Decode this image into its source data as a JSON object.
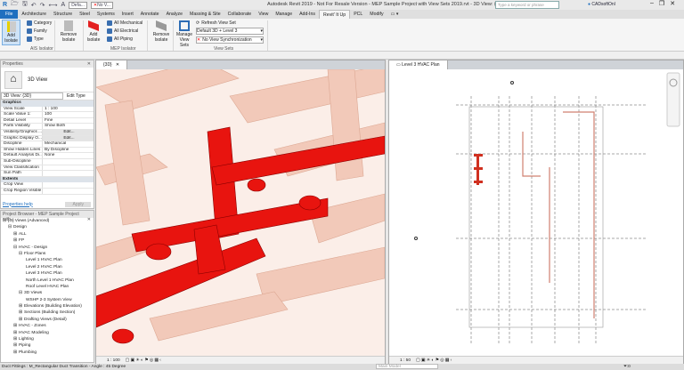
{
  "title": "Autodesk Revit 2019 - Not For Resale Version - MEP Sample Project with View Sets 2019.rvt - 3D View: {3D}",
  "qat": {
    "view_select": "Defa...",
    "sync_select": "No V..."
  },
  "search_placeholder": "Type a keyword or phrase",
  "user": "CADsoftOnl",
  "tabs": [
    "File",
    "Architecture",
    "Structure",
    "Steel",
    "Systems",
    "Insert",
    "Annotate",
    "Analyze",
    "Massing & Site",
    "Collaborate",
    "View",
    "Manage",
    "Add-Ins",
    "Revit' It Up",
    "PCL",
    "Modify",
    "▭ ▾"
  ],
  "active_tab": "Revit' It Up",
  "ribbon": {
    "ais": {
      "add_isolate": "Add Isolate",
      "category": "Category",
      "family": "Family",
      "type": "Type",
      "label": "AIS Isolator"
    },
    "remove_isolate_1": "Remove Isolate",
    "mep": {
      "add_isolate": "Add Isolate",
      "all_mechanical": "All Mechanical",
      "all_electrical": "All Electrical",
      "all_piping": "All Piping",
      "label": "MEP Isolator"
    },
    "remove_isolate_2": "Remove Isolate",
    "viewsets": {
      "manage": "Manage View Sets",
      "refresh": "Refresh View Set",
      "default_set": "Default 3D + Level 3",
      "sync": "No View Synchronization",
      "label": "View Sets"
    }
  },
  "properties": {
    "title": "Properties",
    "type_name": "3D View",
    "selector": "3D View: {3D}",
    "edit_type": "Edit Type",
    "sections": {
      "graphics": "Graphics",
      "extents": "Extents"
    },
    "rows": [
      {
        "k": "View Scale",
        "v": "1 : 100"
      },
      {
        "k": "Scale Value    1:",
        "v": "100"
      },
      {
        "k": "Detail Level",
        "v": "Fine"
      },
      {
        "k": "Parts Visibility",
        "v": "Show Both"
      },
      {
        "k": "Visibility/Graphics ...",
        "v": "Edit..."
      },
      {
        "k": "Graphic Display O...",
        "v": "Edit..."
      },
      {
        "k": "Discipline",
        "v": "Mechanical"
      },
      {
        "k": "Show Hidden Lines",
        "v": "By Discipline"
      },
      {
        "k": "Default Analysis Di...",
        "v": "None"
      },
      {
        "k": "Sub-Discipline",
        "v": ""
      },
      {
        "k": "View Classification",
        "v": ""
      },
      {
        "k": "Sun Path",
        "v": ""
      }
    ],
    "extents_rows": [
      {
        "k": "Crop View",
        "v": ""
      },
      {
        "k": "Crop Region Visible",
        "v": ""
      }
    ],
    "help": "Properties help",
    "apply": "Apply"
  },
  "browser": {
    "title": "Project Browser - MEP Sample Project with...",
    "items": [
      {
        "t": "[O] Views (Advanced)",
        "d": 0,
        "s": "⊟"
      },
      {
        "t": "Design",
        "d": 1,
        "s": "⊟"
      },
      {
        "t": "ALL",
        "d": 2,
        "s": "⊞"
      },
      {
        "t": "FP",
        "d": 2,
        "s": "⊞"
      },
      {
        "t": "HVAC - Design",
        "d": 2,
        "s": "⊟"
      },
      {
        "t": "Floor Plans",
        "d": 3,
        "s": "⊟"
      },
      {
        "t": "Level 1 HVAC Plan",
        "d": 4,
        "s": ""
      },
      {
        "t": "Level 2 HVAC Plan",
        "d": 4,
        "s": ""
      },
      {
        "t": "Level 3 HVAC Plan",
        "d": 4,
        "s": ""
      },
      {
        "t": "North Level 1 HVAC Plan",
        "d": 4,
        "s": ""
      },
      {
        "t": "Roof Level HVAC Plan",
        "d": 4,
        "s": ""
      },
      {
        "t": "3D Views",
        "d": 3,
        "s": "⊟"
      },
      {
        "t": "WSHP 2-3 System View",
        "d": 4,
        "s": ""
      },
      {
        "t": "Elevations (Building Elevation)",
        "d": 3,
        "s": "⊞"
      },
      {
        "t": "Sections (Building Section)",
        "d": 3,
        "s": "⊞"
      },
      {
        "t": "Drafting Views (Detail)",
        "d": 3,
        "s": "⊞"
      },
      {
        "t": "HVAC - Zones",
        "d": 2,
        "s": "⊞"
      },
      {
        "t": "HVAC Modeling",
        "d": 2,
        "s": "⊞"
      },
      {
        "t": "Lighting",
        "d": 2,
        "s": "⊞"
      },
      {
        "t": "Piping",
        "d": 2,
        "s": "⊞"
      },
      {
        "t": "Plumbing",
        "d": 2,
        "s": "⊞"
      }
    ]
  },
  "view3d": {
    "tab": "{3D}",
    "scale": "1 : 100"
  },
  "viewplan": {
    "tab": "Level 3 HVAC Plan",
    "scale": "1 : 50"
  },
  "status": {
    "text": "Duct Fittings : M_Rectangular Duct Transition - Angle : 45 Degree",
    "model": "Main Model",
    "filter_count": ":0"
  },
  "colors": {
    "accent": "#1f6fbf",
    "duct": "#f3c7b6",
    "selected": "#e8140f"
  }
}
